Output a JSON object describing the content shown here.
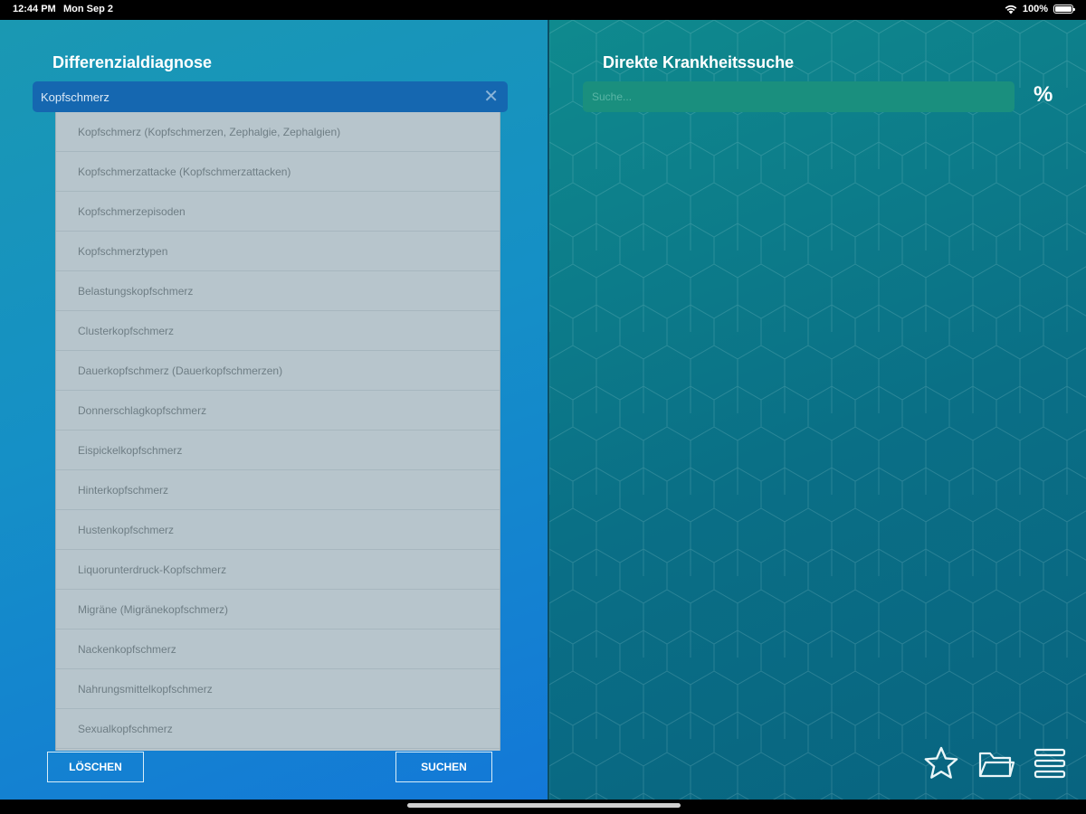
{
  "status_bar": {
    "time": "12:44 PM",
    "date": "Mon Sep 2",
    "battery": "100%"
  },
  "left_panel": {
    "title": "Differenzialdiagnose",
    "search_value": "Kopfschmerz",
    "clear_icon": "close-icon",
    "suggestions": [
      "Kopfschmerz (Kopfschmerzen, Zephalgie, Zephalgien)",
      "Kopfschmerzattacke (Kopfschmerzattacken)",
      "Kopfschmerzepisoden",
      "Kopfschmerztypen",
      "Belastungskopfschmerz",
      "Clusterkopfschmerz",
      "Dauerkopfschmerz (Dauerkopfschmerzen)",
      "Donnerschlagkopfschmerz",
      "Eispickelkopfschmerz",
      "Hinterkopfschmerz",
      "Hustenkopfschmerz",
      "Liquorunterdruck-Kopfschmerz",
      "Migräne (Migränekopfschmerz)",
      "Nackenkopfschmerz",
      "Nahrungsmittelkopfschmerz",
      "Sexualkopfschmerz"
    ],
    "clear_button": "LÖSCHEN",
    "search_button": "SUCHEN"
  },
  "right_panel": {
    "title": "Direkte Krankheitssuche",
    "search_placeholder": "Suche...",
    "percent_label": "%",
    "bottom_icons": [
      "star-icon",
      "folder-icon",
      "menu-icon"
    ]
  },
  "colors": {
    "left_accent": "#1590c6",
    "right_accent": "#0a6f86",
    "search_box": "#1567b0",
    "dropdown_bg": "#b7c5cc"
  }
}
